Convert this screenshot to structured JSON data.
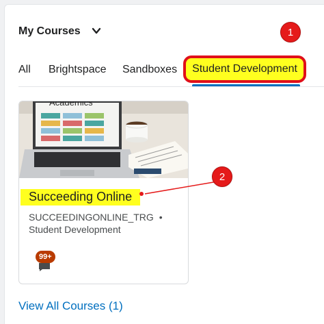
{
  "header": {
    "title": "My Courses"
  },
  "tabs": [
    {
      "label": "All"
    },
    {
      "label": "Brightspace"
    },
    {
      "label": "Sandboxes"
    },
    {
      "label": "Student Development"
    }
  ],
  "callouts": {
    "one": "1",
    "two": "2"
  },
  "course": {
    "image_text": "Academics",
    "title": "Succeeding Online",
    "code": "SUCCEEDINGONLINE_TRG",
    "separator": "•",
    "department": "Student Development",
    "badge": "99+"
  },
  "footer": {
    "view_all": "View All Courses (1)"
  },
  "colors": {
    "highlight": "#ffff1f",
    "annotation_red": "#e51a1a",
    "link_blue": "#006fbf",
    "badge": "#b93b00"
  }
}
